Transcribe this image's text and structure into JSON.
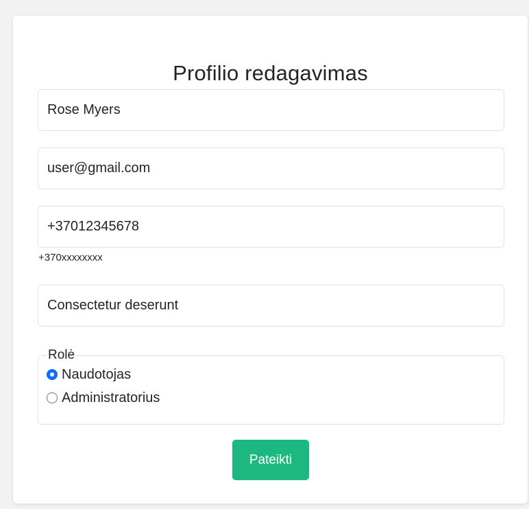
{
  "form": {
    "title": "Profilio redagavimas",
    "name_value": "Rose Myers",
    "email_value": "user@gmail.com",
    "phone_value": "+37012345678",
    "phone_hint": "+370xxxxxxxx",
    "description_value": "Consectetur deserunt",
    "role": {
      "legend": "Rolė",
      "options": [
        {
          "label": "Naudotojas",
          "checked": true
        },
        {
          "label": "Administratorius",
          "checked": false
        }
      ]
    },
    "submit_label": "Pateikti"
  },
  "colors": {
    "submit_bg": "#1cb880",
    "radio_checked": "#0d6efd"
  }
}
